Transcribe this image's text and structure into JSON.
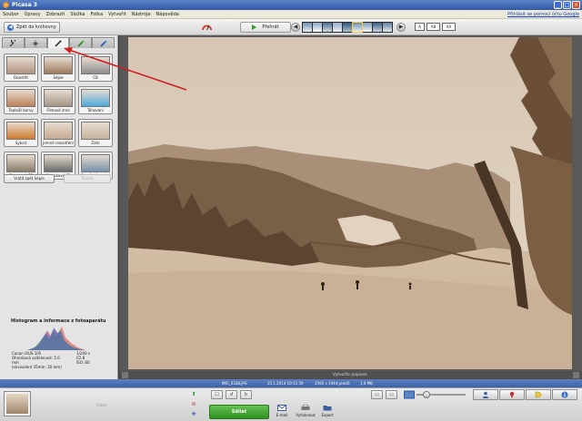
{
  "window": {
    "title": "Picasa 3",
    "min": "_",
    "max": "□",
    "close": "×"
  },
  "menu": {
    "items": [
      "Soubor",
      "Úpravy",
      "Zobrazit",
      "Složka",
      "Fotka",
      "Vytvořit",
      "Nástroje",
      "Nápověda"
    ],
    "signin": "Přihlásit se pomocí účtu Google"
  },
  "toolbar": {
    "back_label": "Zpět do knihovny",
    "back_arrow": "◀",
    "play_label": "Přehrát",
    "prev": "◀",
    "next": "▶",
    "view_options": [
      "A",
      "AB",
      "AA"
    ]
  },
  "effects": [
    {
      "label": "Doostřit",
      "tone": "#b39480",
      "badge": ""
    },
    {
      "label": "Sépie",
      "tone": "#9c7a59",
      "badge": ""
    },
    {
      "label": "ČB",
      "tone": "#8d8d8d",
      "badge": ""
    },
    {
      "label": "Teplejší barvy",
      "tone": "#bf825c",
      "badge": ""
    },
    {
      "label": "Filmové zrno",
      "tone": "#a59484",
      "badge": ""
    },
    {
      "label": "Tónování",
      "tone": "#4da9de",
      "badge": ""
    },
    {
      "label": "Sytost",
      "tone": "#d07a2c",
      "badge": ""
    },
    {
      "label": "Jemné rozostření",
      "tone": "#c7aa92",
      "badge": ""
    },
    {
      "label": "Záře",
      "tone": "#c8b49e",
      "badge": ""
    },
    {
      "label": "Filtrované ČB",
      "tone": "#8a7a6a",
      "badge": ""
    },
    {
      "label": "Ohniskové ČB",
      "tone": "#6a6a6a",
      "badge": ""
    },
    {
      "label": "Stupň. tónování",
      "tone": "#7591a9",
      "badge": ""
    }
  ],
  "actions": {
    "undo": "Vrátit zpět Sépie",
    "redo": "Znovu"
  },
  "histogram": {
    "title": "Histogram a informace z fotoaparátu",
    "left_lines": [
      "Canon IXUS 105",
      "Ohnisková vzdálenost: 5.0",
      "mm",
      "(ekvivalent 35mm: 30 mm)"
    ],
    "right_lines": [
      "1/200 s",
      "f/2.8",
      "ISO: 80"
    ]
  },
  "photo": {
    "caption_placeholder": "Vytvořte popisek."
  },
  "status": {
    "filename": "IMG_0338.JPG",
    "date": "25.1.2014 10:11:59",
    "dimensions": "2592 x 1944 pixelů",
    "size": "1,0 MB"
  },
  "tray": {
    "label": "Výběr"
  },
  "bottom": {
    "share_label": "Sdílet",
    "email_label": "E-mail",
    "print_label": "Vytisknout",
    "export_label": "Export",
    "hold_icon": "⬆",
    "clear_icon": "⊘",
    "tag_icon": "✚",
    "tool_icons": [
      "☐",
      "↺",
      "↻",
      "▭",
      "▭"
    ]
  },
  "colors": {
    "accent": "#3e62a8",
    "share": "#2f8f23",
    "arrow": "#d11f1f"
  },
  "slider_fraction": 0.15
}
